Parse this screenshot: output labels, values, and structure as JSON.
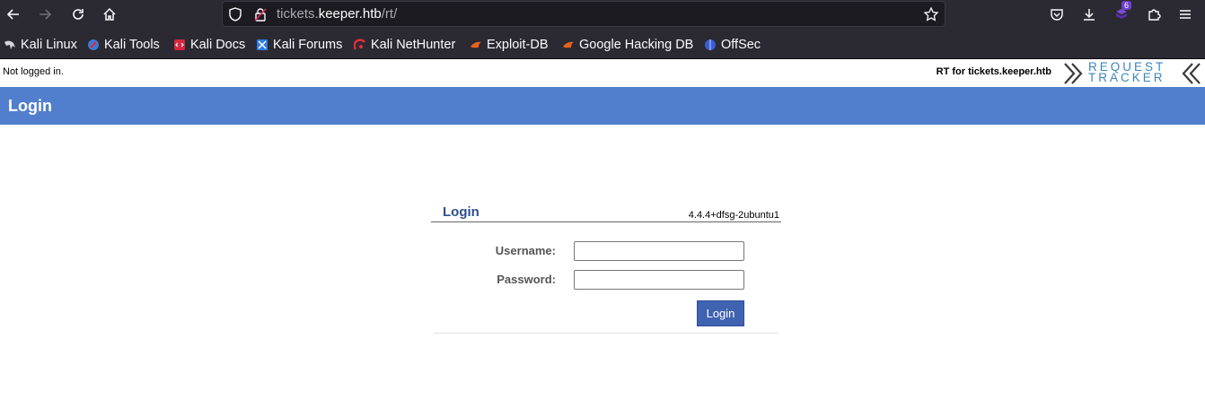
{
  "browser": {
    "url_host_prefix": "tickets.",
    "url_host_main": "keeper.htb",
    "url_path": "/rt/",
    "extension_badge": "6",
    "bookmarks": [
      {
        "label": "Kali Linux",
        "icon": "kali-dragon-icon"
      },
      {
        "label": "Kali Tools",
        "icon": "kali-tools-icon"
      },
      {
        "label": "Kali Docs",
        "icon": "kali-docs-icon"
      },
      {
        "label": "Kali Forums",
        "icon": "kali-forums-icon"
      },
      {
        "label": "Kali NetHunter",
        "icon": "nethunter-icon"
      },
      {
        "label": "Exploit-DB",
        "icon": "exploitdb-icon"
      },
      {
        "label": "Google Hacking DB",
        "icon": "ghdb-icon"
      },
      {
        "label": "OffSec",
        "icon": "offsec-icon"
      }
    ]
  },
  "rt": {
    "status": "Not logged in.",
    "rt_for": "RT for tickets.keeper.htb",
    "logo_line1": "REQUEST",
    "logo_line2": "TRACKER",
    "page_title": "Login",
    "box_title": "Login",
    "version": "4.4.4+dfsg-2ubuntu1",
    "username_label": "Username:",
    "password_label": "Password:",
    "username_value": "",
    "password_value": "",
    "login_button": "Login",
    "colors": {
      "header": "#527fcd",
      "button": "#3f63b1",
      "title": "#2e4e8d"
    }
  }
}
